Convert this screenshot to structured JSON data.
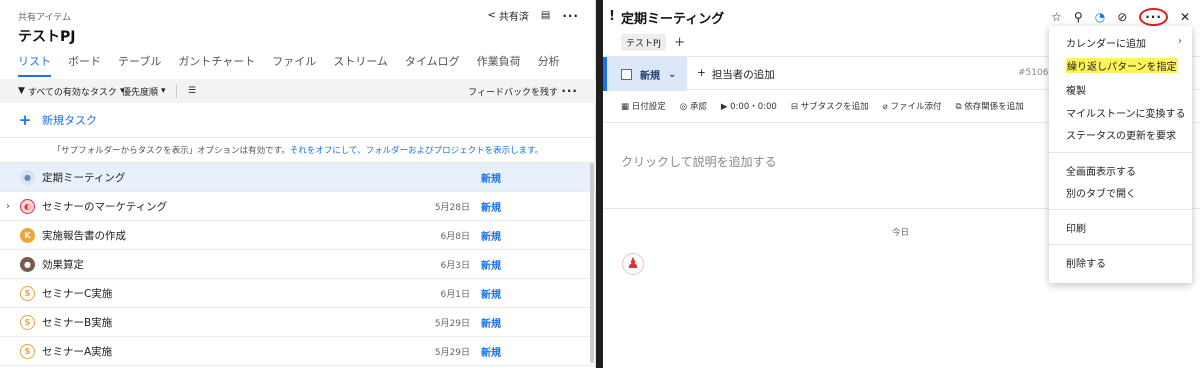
{
  "left": {
    "breadcrumb": "共有アイテム",
    "title": "テストPJ",
    "share_label": "共有済",
    "tabs": [
      "リスト",
      "ボード",
      "テーブル",
      "ガントチャート",
      "ファイル",
      "ストリーム",
      "タイムログ",
      "作業負荷",
      "分析"
    ],
    "toolbar": {
      "filter": "すべての有効なタスク",
      "sort": "優先度順",
      "feedback": "フィードバックを残す"
    },
    "new_task": "新規タスク",
    "notice": {
      "text": "「サブフォルダーからタスクを表示」オプションは有効です。",
      "link": "それをオフにして、フォルダーおよびプロジェクトを表示します。"
    },
    "rows": [
      {
        "name": "定期ミーティング",
        "date": "",
        "status": "新規",
        "avatar": "ppl"
      },
      {
        "name": "セミナーのマーケティング",
        "date": "5月28日",
        "status": "新規",
        "avatar": "seg"
      },
      {
        "name": "実施報告書の作成",
        "date": "6月8日",
        "status": "新規",
        "avatar": "k"
      },
      {
        "name": "効果算定",
        "date": "6月3日",
        "status": "新規",
        "avatar": "person"
      },
      {
        "name": "セミナーC実施",
        "date": "6月1日",
        "status": "新規",
        "avatar": "ss"
      },
      {
        "name": "セミナーB実施",
        "date": "5月29日",
        "status": "新規",
        "avatar": "ss"
      },
      {
        "name": "セミナーA実施",
        "date": "5月29日",
        "status": "新規",
        "avatar": "ss"
      }
    ]
  },
  "right": {
    "title": "定期ミーティング",
    "tag": "テストPJ",
    "status": "新規",
    "add_assignee": "担当者の追加",
    "task_id": "#51061",
    "actions": [
      "日付設定",
      "承認",
      "0:00・0:00",
      "サブタスクを追加",
      "ファイル添付",
      "依存関係を追加"
    ],
    "description_placeholder": "クリックして説明を追加する",
    "today": "今日"
  },
  "menu": {
    "items": [
      "カレンダーに追加",
      "繰り返しパターンを指定",
      "複製",
      "マイルストーンに変換する",
      "ステータスの更新を要求",
      "全画面表示する",
      "別のタブで開く",
      "印刷",
      "削除する"
    ]
  }
}
